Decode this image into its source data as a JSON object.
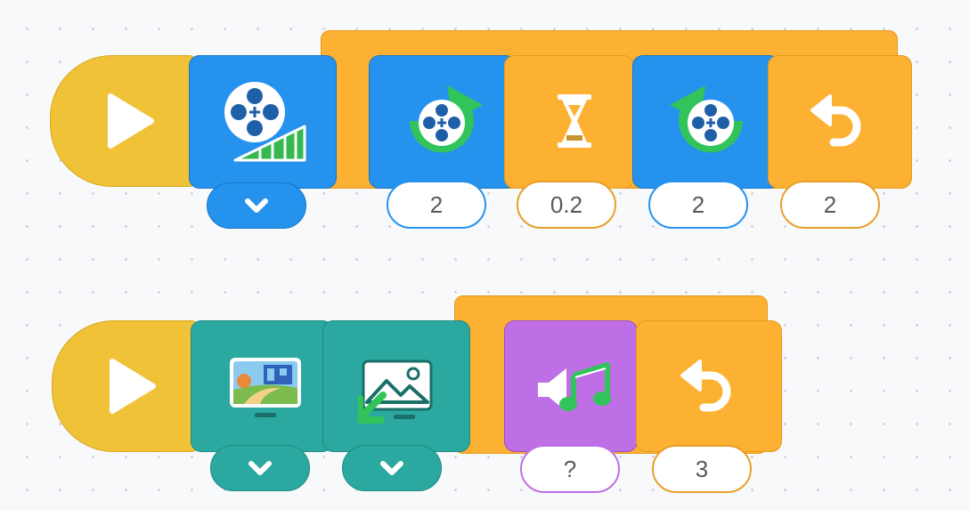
{
  "colors": {
    "event": "#f0c237",
    "control": "#fcb133",
    "motion": "#2592ee",
    "looks": "#2ba9a0",
    "sound": "#bf6fe6",
    "canvas": "#f8f9fb"
  },
  "script1": {
    "start_icon": "play-icon",
    "set_speed": {
      "icon": "motor-speed-icon",
      "dropdown_icon": "chevron-down-icon"
    },
    "repeat_loop": {
      "times": "2",
      "inner": [
        {
          "icon": "motor-spin-clockwise-icon",
          "value": "2"
        },
        {
          "icon": "hourglass-wait-icon",
          "value": "0.2"
        },
        {
          "icon": "motor-spin-counterclockwise-icon",
          "value": "2"
        }
      ],
      "end_icon": "loop-return-icon"
    }
  },
  "script2": {
    "start_icon": "play-icon",
    "set_backdrop": {
      "icon": "backdrop-scene-icon",
      "dropdown_icon": "chevron-down-icon"
    },
    "switch_image": {
      "icon": "image-switch-icon",
      "dropdown_icon": "chevron-down-icon"
    },
    "repeat_loop": {
      "times": "3",
      "inner": [
        {
          "icon": "play-sound-icon",
          "value": "?"
        }
      ],
      "end_icon": "loop-return-icon"
    }
  }
}
